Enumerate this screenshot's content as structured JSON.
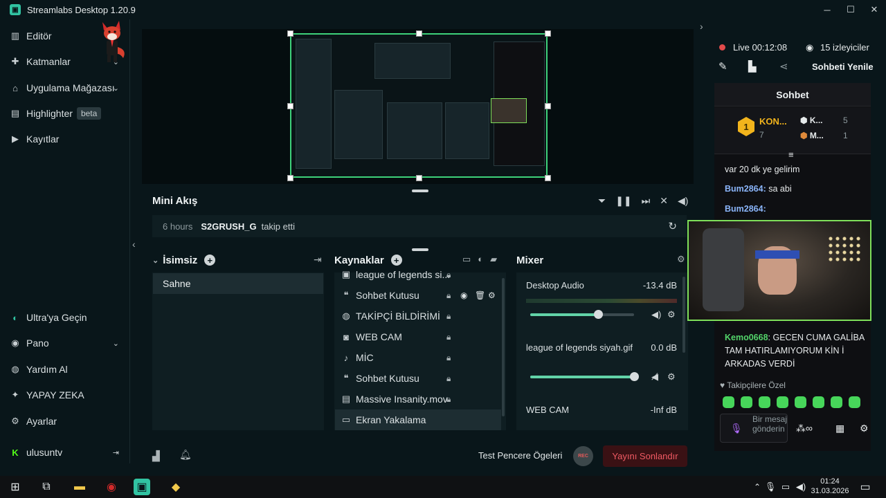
{
  "app": {
    "title": "Streamlabs Desktop 1.20.9",
    "window_controls": [
      "─",
      "☐",
      "✕"
    ]
  },
  "sidebar": {
    "items": [
      {
        "label": "Editör",
        "icon": "editor-icon"
      },
      {
        "label": "Katmanlar",
        "icon": "layers-icon",
        "chevron": "⌄"
      },
      {
        "label": "Uygulama Mağazası",
        "icon": "store-icon",
        "chevron": "⌄"
      },
      {
        "label": "Highlighter",
        "icon": "highlighter-icon",
        "badge": "beta"
      },
      {
        "label": "Kayıtlar",
        "icon": "recordings-icon"
      }
    ],
    "bottom_items": [
      {
        "label": "Ultra'ya Geçin",
        "icon": "ultra-icon"
      },
      {
        "label": "Pano",
        "icon": "dashboard-icon",
        "chevron": "⌄"
      },
      {
        "label": "Yardım Al",
        "icon": "help-icon"
      },
      {
        "label": "YAPAY ZEKA",
        "icon": "ai-icon"
      },
      {
        "label": "Ayarlar",
        "icon": "settings-icon"
      }
    ],
    "account": {
      "name": "ulusuntv",
      "logout_icon": "logout-icon"
    }
  },
  "mini_feed": {
    "title": "Mini Akış",
    "event": {
      "time": "6 hours",
      "user": "S2GRUSH_G",
      "action": "takip etti"
    }
  },
  "scenes": {
    "title": "İsimsiz",
    "items": [
      "Sahne"
    ]
  },
  "sources": {
    "title": "Kaynaklar",
    "items": [
      {
        "label": "league of legends si...",
        "icon": "image-icon"
      },
      {
        "label": "Sohbet Kutusu",
        "icon": "chat-icon"
      },
      {
        "label": "TAKİPÇİ BİLDİRİMİ",
        "icon": "globe-icon"
      },
      {
        "label": "WEB CAM",
        "icon": "webcam-icon"
      },
      {
        "label": "MİC",
        "icon": "mic-icon"
      },
      {
        "label": "Sohbet Kutusu",
        "icon": "chat-icon"
      },
      {
        "label": "Massive Insanity.mov",
        "icon": "file-icon"
      },
      {
        "label": "Ekran Yakalama",
        "icon": "monitor-icon"
      }
    ]
  },
  "mixer": {
    "title": "Mixer",
    "channels": [
      {
        "name": "Desktop Audio",
        "db": "-13.4 dB",
        "level": 0.65
      },
      {
        "name": "league of legends siyah.gif",
        "db": "0.0 dB",
        "level": 1.0
      },
      {
        "name": "WEB CAM",
        "db": "-Inf dB",
        "level": 0.0
      }
    ]
  },
  "bottom_bar": {
    "test_label": "Test Pencere Ögeleri",
    "rec_label": "REC",
    "stop_label": "Yayını Sonlandır"
  },
  "stream": {
    "live_time": "Live 00:12:08",
    "viewers": "15 izleyiciler",
    "refresh_chat": "Sohbeti Yenile"
  },
  "chat": {
    "title": "Sohbet",
    "top_chatter": {
      "name": "KON...",
      "count": "7"
    },
    "ranks": [
      {
        "name": "K...",
        "count": "5"
      },
      {
        "name": "M...",
        "count": "1"
      }
    ],
    "messages": [
      {
        "user": "",
        "text": "var 20 dk ye gelirim"
      },
      {
        "user": "Bum2864:",
        "text": "sa abi"
      },
      {
        "user": "Bum2864:",
        "text": ""
      }
    ],
    "highlight": {
      "user": "Kemo0668",
      "text": ": GECEN CUMA GALİBA TAM HATIRLAMIYORUM KİN İ ARKADAS VERDİ"
    },
    "followers_only": "Takipçilere Özel",
    "input_placeholder": "Bir mesaj gönderin"
  },
  "taskbar": {
    "time": "01:24",
    "date": "31.03.2026"
  },
  "colors": {
    "accent": "#31c3a2",
    "live": "#e24b4b",
    "stop": "#f05a63",
    "cam_border": "#7fe05a",
    "chat_user": "#8ab4f8"
  }
}
